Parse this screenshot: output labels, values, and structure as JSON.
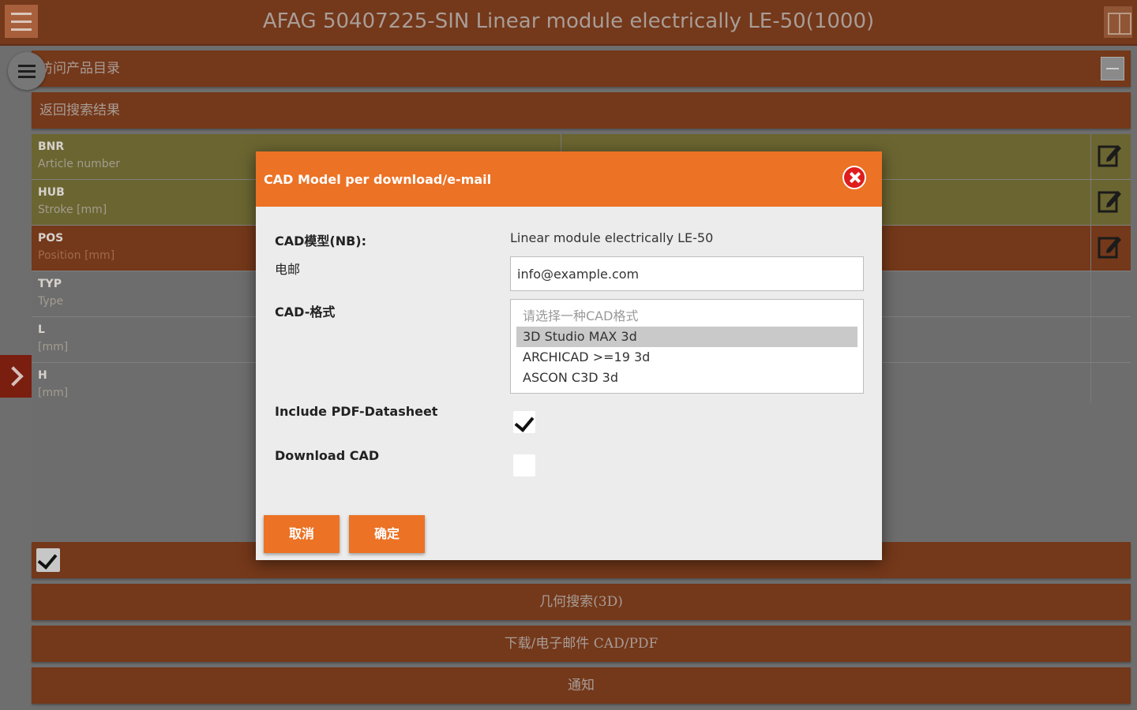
{
  "app": {
    "title": "AFAG 50407225-SIN Linear module electrically LE-50(1000)"
  },
  "nav": {
    "catalog_label": "访问产品目录",
    "back_results_label": "返回搜索结果"
  },
  "table": {
    "rows": [
      {
        "code": "BNR",
        "desc": "Article number",
        "color": "olive"
      },
      {
        "code": "HUB",
        "desc": "Stroke [mm]",
        "color": "olive"
      },
      {
        "code": "POS",
        "desc": "Position [mm]",
        "color": "orange"
      },
      {
        "code": "TYP",
        "desc": "Type",
        "color": "gray"
      },
      {
        "code": "L",
        "desc": "[mm]",
        "color": "gray"
      },
      {
        "code": "H",
        "desc": "[mm]",
        "color": "gray"
      }
    ]
  },
  "bottom_bars": {
    "bar1": "",
    "bar2": "几何搜索(3D)",
    "bar3": "下载/电子邮件 CAD/PDF",
    "bar4": "通知"
  },
  "dialog": {
    "title": "CAD Model per download/e-mail",
    "cad_model_label": "CAD模型(NB):",
    "cad_model_value": "Linear module electrically LE-50",
    "email_label": "电邮",
    "email_value": "info@example.com",
    "format_label": "CAD-格式",
    "format_options": [
      "请选择一种CAD格式",
      "3D Studio MAX 3d",
      "ARCHICAD >=19 3d",
      "ASCON C3D 3d"
    ],
    "selected_format": "3D Studio MAX 3d",
    "include_pdf_label": "Include PDF-Datasheet",
    "include_pdf_checked": true,
    "download_cad_label": "Download CAD",
    "download_cad_checked": false,
    "cancel_label": "取消",
    "ok_label": "确定"
  },
  "colors": {
    "accent": "#ec7225",
    "topbar": "#74381a",
    "close": "#e01c1c"
  }
}
